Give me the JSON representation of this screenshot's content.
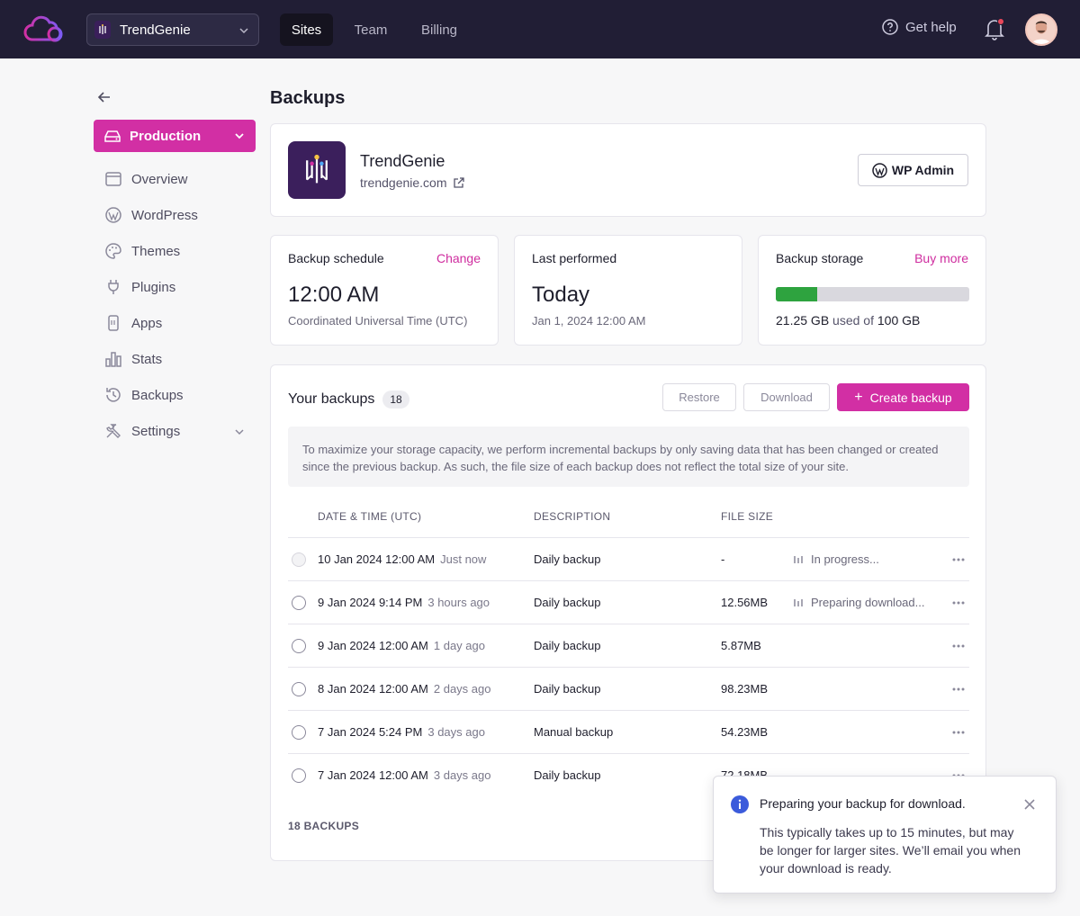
{
  "topbar": {
    "site_name": "TrendGenie",
    "tabs": [
      {
        "label": "Sites",
        "active": true
      },
      {
        "label": "Team",
        "active": false
      },
      {
        "label": "Billing",
        "active": false
      }
    ],
    "help_label": "Get help",
    "notification_dot_color": "#e9475a",
    "nav_bg": "#211e35"
  },
  "sidebar": {
    "environment": "Production",
    "items": [
      {
        "label": "Overview",
        "icon": "browser-window-icon"
      },
      {
        "label": "WordPress",
        "icon": "wordpress-icon"
      },
      {
        "label": "Themes",
        "icon": "palette-icon"
      },
      {
        "label": "Plugins",
        "icon": "plug-icon"
      },
      {
        "label": "Apps",
        "icon": "app-icon"
      },
      {
        "label": "Stats",
        "icon": "bar-chart-icon"
      },
      {
        "label": "Backups",
        "icon": "history-icon"
      },
      {
        "label": "Settings",
        "icon": "tools-icon"
      }
    ],
    "accent": "#d22fa4"
  },
  "main": {
    "page_title": "Backups",
    "site": {
      "name": "TrendGenie",
      "url": "trendgenie.com",
      "wp_admin_label": "WP Admin"
    },
    "schedule": {
      "title": "Backup schedule",
      "link": "Change",
      "time": "12:00 AM",
      "tz": "Coordinated Universal Time (UTC)"
    },
    "last_performed": {
      "title": "Last performed",
      "value": "Today",
      "sub": "Jan 1, 2024 12:00 AM"
    },
    "storage": {
      "title": "Backup storage",
      "link": "Buy more",
      "used": "21.25 GB",
      "used_of": "used of",
      "total": "100 GB",
      "fraction_used": 0.2125,
      "fill_color": "#2ea33f"
    },
    "backups": {
      "title": "Your backups",
      "count": "18",
      "restore_label": "Restore",
      "download_label": "Download",
      "create_label": "Create backup",
      "notice": "To maximize your storage capacity, we perform incremental backups by only saving data that has been changed or created since the previous backup. As such, the file size of each backup does not reflect the total size of your site.",
      "columns": [
        "DATE & TIME (UTC)",
        "DESCRIPTION",
        "FILE SIZE"
      ],
      "rows": [
        {
          "date": "10 Jan 2024 12:00 AM",
          "ago": "Just now",
          "desc": "Daily backup",
          "size": "-",
          "status": "In progress..."
        },
        {
          "date": "9 Jan 2024 9:14 PM",
          "ago": "3 hours ago",
          "desc": "Daily backup",
          "size": "12.56MB",
          "status": "Preparing download..."
        },
        {
          "date": "9 Jan 2024 12:00 AM",
          "ago": "1 day ago",
          "desc": "Daily backup",
          "size": "5.87MB",
          "status": ""
        },
        {
          "date": "8 Jan 2024 12:00 AM",
          "ago": "2 days ago",
          "desc": "Daily backup",
          "size": "98.23MB",
          "status": ""
        },
        {
          "date": "7 Jan 2024 5:24 PM",
          "ago": "3 days ago",
          "desc": "Manual backup",
          "size": "54.23MB",
          "status": ""
        },
        {
          "date": "7 Jan 2024 12:00 AM",
          "ago": "3 days ago",
          "desc": "Daily backup",
          "size": "72.18MB",
          "status": ""
        }
      ],
      "footer": "18 BACKUPS"
    }
  },
  "toast": {
    "title": "Preparing your backup for download.",
    "body": "This typically takes up to 15 minutes, but may be longer for larger sites. We’ll email you when your download is ready.",
    "info_color": "#3b5bdb"
  }
}
